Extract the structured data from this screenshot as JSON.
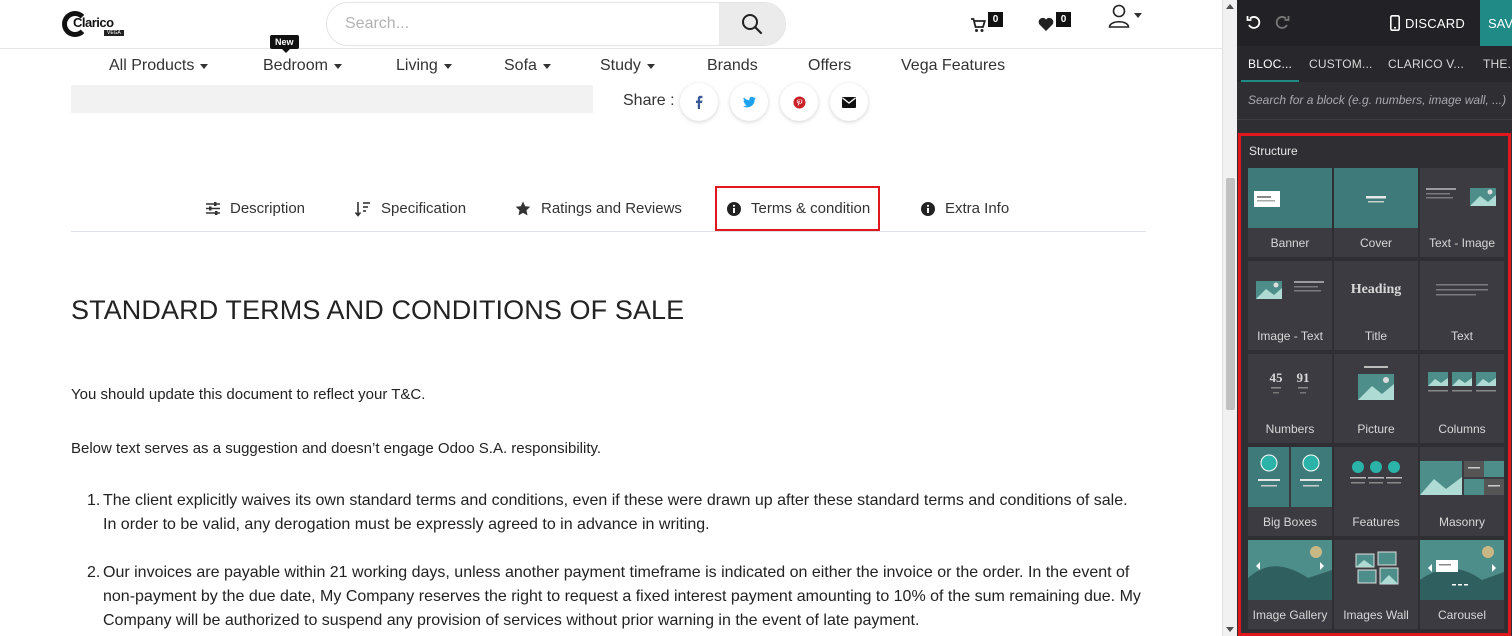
{
  "header": {
    "logo_text": "Clarico",
    "logo_tag": "VEGA",
    "search_placeholder": "Search...",
    "cart_count": "0",
    "wishlist_count": "0"
  },
  "nav": {
    "new_badge": "New",
    "items": [
      "All Products",
      "Bedroom",
      "Living",
      "Sofa",
      "Study",
      "Brands",
      "Offers",
      "Vega Features"
    ]
  },
  "share": {
    "label": "Share :"
  },
  "tabs": [
    "Description",
    "Specification",
    "Ratings and Reviews",
    "Terms & condition",
    "Extra Info"
  ],
  "content": {
    "title": "STANDARD TERMS AND CONDITIONS OF SALE",
    "para1": "You should update this document to reflect your T&C.",
    "para2": "Below text serves as a suggestion and doesn’t engage Odoo S.A. responsibility.",
    "list": [
      {
        "num": "1.",
        "line1": "The client explicitly waives its own standard terms and conditions, even if these were drawn up after these standard terms and conditions of sale.",
        "line2": "In order to be valid, any derogation must be expressly agreed to in advance in writing."
      },
      {
        "num": "2.",
        "line1": "Our invoices are payable within 21 working days, unless another payment timeframe is indicated on either the invoice or the order. In the event of",
        "line2": "non-payment by the due date, My Company reserves the right to request a fixed interest payment amounting to 10% of the sum remaining due. My",
        "line3": "Company will be authorized to suspend any provision of services without prior warning in the event of late payment."
      }
    ]
  },
  "editor": {
    "discard": "DISCARD",
    "save": "SAVE",
    "tabs": [
      "BLOC...",
      "CUSTOM...",
      "CLARICO V...",
      "THE..."
    ],
    "search_placeholder": "Search for a block (e.g. numbers, image wall, ...)",
    "section_label": "Structure",
    "blocks": [
      "Banner",
      "Cover",
      "Text - Image",
      "Image - Text",
      "Title",
      "Text",
      "Numbers",
      "Picture",
      "Columns",
      "Big Boxes",
      "Features",
      "Masonry",
      "Image Gallery",
      "Images Wall",
      "Carousel"
    ],
    "thumb_heading": "Heading",
    "thumb_num_a": "45",
    "thumb_num_b": "91"
  },
  "colors": {
    "highlight": "#e0171c",
    "teal": "#1f8a86",
    "panel_bg": "#2e2e33"
  }
}
